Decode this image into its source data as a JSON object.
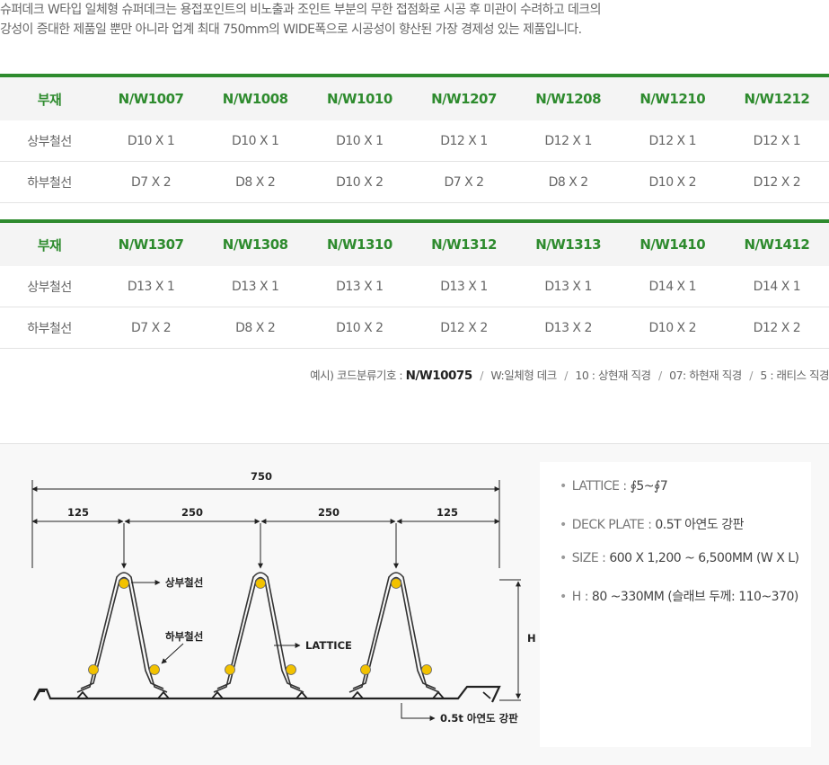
{
  "intro": {
    "line1": "슈퍼데크 W타입 일체형 슈퍼데크는 용접포인트의 비노출과 조인트 부분의 무한 접점화로 시공 후 미관이 수려하고 데크의",
    "line2": "강성이 증대한 제품일 뿐만 아니라 업계 최대 750mm의 WIDE폭으로 시공성이 향산된 가장 경제성 있는 제품입니다."
  },
  "table1": {
    "header": [
      "부재",
      "N/W1007",
      "N/W1008",
      "N/W1010",
      "N/W1207",
      "N/W1208",
      "N/W1210",
      "N/W1212"
    ],
    "rows": [
      [
        "상부철선",
        "D10 X 1",
        "D10 X 1",
        "D10 X 1",
        "D12 X 1",
        "D12 X 1",
        "D12 X 1",
        "D12 X 1"
      ],
      [
        "하부철선",
        "D7 X 2",
        "D8 X 2",
        "D10 X 2",
        "D7 X 2",
        "D8 X 2",
        "D10 X 2",
        "D12 X 2"
      ]
    ]
  },
  "table2": {
    "header": [
      "부재",
      "N/W1307",
      "N/W1308",
      "N/W1310",
      "N/W1312",
      "N/W1313",
      "N/W1410",
      "N/W1412"
    ],
    "rows": [
      [
        "상부철선",
        "D13 X 1",
        "D13 X 1",
        "D13 X 1",
        "D13 X 1",
        "D13 X 1",
        "D14 X 1",
        "D14 X 1"
      ],
      [
        "하부철선",
        "D7 X 2",
        "D8 X 2",
        "D10 X 2",
        "D12 X 2",
        "D13 X 2",
        "D10 X 2",
        "D12 X 2"
      ]
    ]
  },
  "legend": {
    "prefix": "예시) 코드분류기호 :",
    "code": "N/W10075",
    "items": [
      "W:일체형 데크",
      "10 : 상현재 직경",
      "07: 하현재 직경",
      "5 : 래티스 직경"
    ],
    "separator": "/"
  },
  "diagram": {
    "total_width": "750",
    "segments": [
      "125",
      "250",
      "250",
      "125"
    ],
    "label_upper": "상부철선",
    "label_lower": "하부철선",
    "label_lattice": "LATTICE",
    "label_height": "H",
    "label_plate": "0.5t 아연도 강판",
    "colors": {
      "rebar": "#f2c200",
      "line": "#222222"
    }
  },
  "info": {
    "items": [
      {
        "key": "LATTICE :",
        "value": "∮5~∮7"
      },
      {
        "key": "DECK PLATE :",
        "value": "0.5T 아연도 강판"
      },
      {
        "key": "SIZE :",
        "value": "600 X 1,200 ~ 6,500MM (W X L)"
      },
      {
        "key": "H :",
        "value": "80 ~330MM (슬래브 두께: 110~370)"
      }
    ]
  },
  "colors": {
    "accent": "#2e8b2e",
    "header_bg": "#f4f4f4"
  }
}
